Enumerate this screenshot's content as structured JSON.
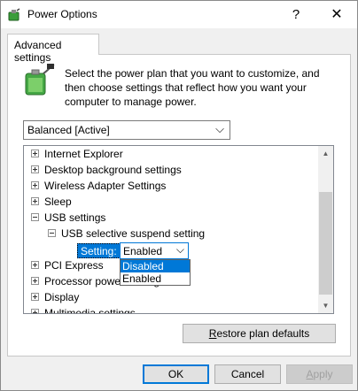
{
  "window": {
    "title": "Power Options",
    "help_glyph": "?",
    "close_glyph": "✕"
  },
  "tab": {
    "label": "Advanced settings"
  },
  "description": "Select the power plan that you want to customize, and then choose settings that reflect how you want your computer to manage power.",
  "plan_select": {
    "value": "Balanced [Active]",
    "chevron": "⌵"
  },
  "tree": {
    "items": [
      {
        "label": "Internet Explorer",
        "expanded": false
      },
      {
        "label": "Desktop background settings",
        "expanded": false
      },
      {
        "label": "Wireless Adapter Settings",
        "expanded": false
      },
      {
        "label": "Sleep",
        "expanded": false
      },
      {
        "label": "USB settings",
        "expanded": true
      },
      {
        "label": "USB selective suspend setting",
        "expanded": true
      },
      {
        "label": "PCI Express",
        "expanded": false
      },
      {
        "label": "Processor power management",
        "expanded": false
      },
      {
        "label": "Display",
        "expanded": false
      },
      {
        "label": "Multimedia settings",
        "expanded": false
      }
    ],
    "setting_label": "Setting:",
    "setting_value": "Enabled",
    "setting_chevron": "⌵",
    "dropdown_options": [
      "Disabled",
      "Enabled"
    ],
    "scroll_up": "▲",
    "scroll_down": "▼"
  },
  "buttons": {
    "restore_pre": "",
    "restore_accel": "R",
    "restore_post": "estore plan defaults",
    "ok": "OK",
    "cancel": "Cancel",
    "apply_accel": "A",
    "apply_post": "pply"
  },
  "colors": {
    "selection": "#0078d7",
    "window_bg": "#f0f0f0",
    "battery_green": "#3a9d3a"
  }
}
